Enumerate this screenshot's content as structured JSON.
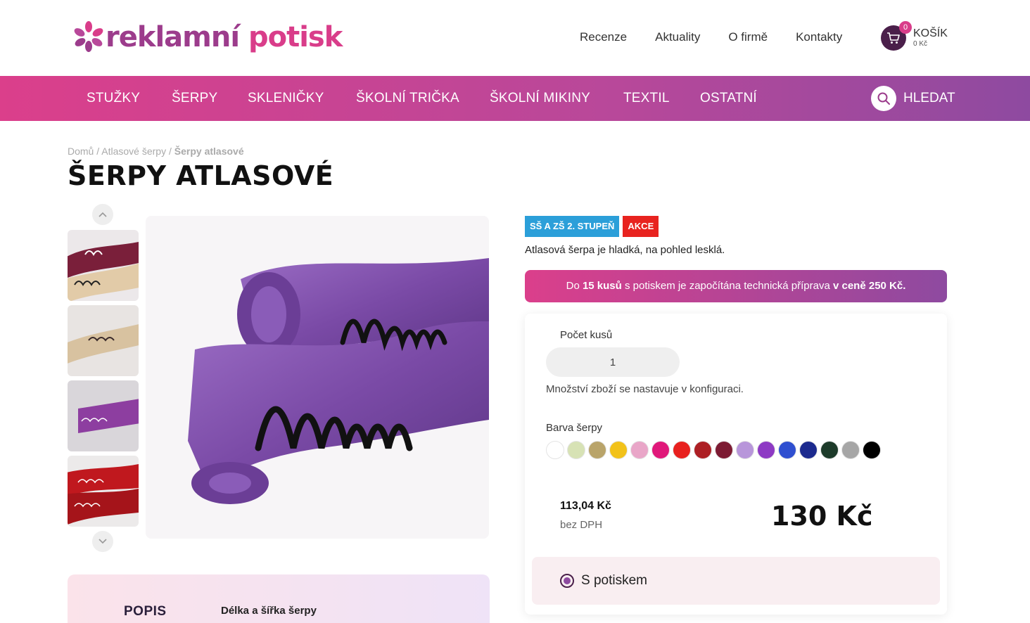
{
  "brand": {
    "word1": "reklamní",
    "word2": "potisk"
  },
  "topnav": [
    "Recenze",
    "Aktuality",
    "O firmě",
    "Kontakty"
  ],
  "cart": {
    "count": "0",
    "title": "KOŠÍK",
    "sum": "0 Kč"
  },
  "mainnav": [
    "STUŽKY",
    "ŠERPY",
    "SKLENIČKY",
    "ŠKOLNÍ TRIČKA",
    "ŠKOLNÍ MIKINY",
    "TEXTIL",
    "OSTATNÍ"
  ],
  "search": {
    "label": "HLEDAT"
  },
  "breadcrumb": {
    "home": "Domů",
    "sep": "/",
    "category": "Atlasové šerpy",
    "current": "Šerpy atlasové"
  },
  "title": "ŠERPY ATLASOVÉ",
  "badges": [
    "SŠ A ZŠ 2. STUPEŇ",
    "AKCE"
  ],
  "short_description": "Atlasová šerpa je hladká, na pohled lesklá.",
  "promo": {
    "p1": "Do ",
    "b1": "15 kusů",
    "p2": " s potiskem je započítána technická příprava ",
    "b2": "v ceně 250 Kč."
  },
  "config": {
    "qty_label": "Počet kusů",
    "qty_value": "1",
    "qty_note": "Množství zboží se nastavuje v konfiguraci.",
    "color_label": "Barva šerpy",
    "colors": [
      "#ffffff",
      "#d7e2b5",
      "#b9a46a",
      "#f2c21a",
      "#e9a6c8",
      "#e0187a",
      "#e8201e",
      "#ad1f24",
      "#7d1b33",
      "#b896da",
      "#8e3ac4",
      "#2f4fd0",
      "#1c2a8e",
      "#1d3b2a",
      "#a6a6a6",
      "#000000"
    ],
    "price_net": "113,04 Kč",
    "price_net_label": "bez DPH",
    "price": "130 Kč",
    "option_label": "S potiskem"
  },
  "description": {
    "tab": "POPIS",
    "heading": "Délka a šířka šerpy"
  },
  "images": {
    "thumb_ribbon_colors": [
      "#7a1f3a",
      "#d8bfa0",
      "#8d3ea0",
      "#c0181e"
    ],
    "main_ribbon_color": "#7a4aa6"
  }
}
